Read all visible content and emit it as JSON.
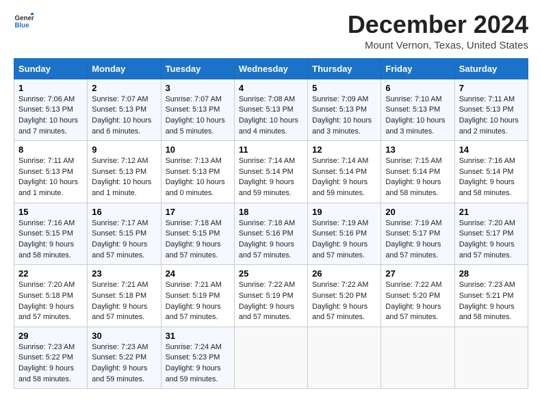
{
  "logo": {
    "line1": "General",
    "line2": "Blue"
  },
  "title": "December 2024",
  "subtitle": "Mount Vernon, Texas, United States",
  "columns": [
    "Sunday",
    "Monday",
    "Tuesday",
    "Wednesday",
    "Thursday",
    "Friday",
    "Saturday"
  ],
  "weeks": [
    [
      {
        "day": "1",
        "info": "Sunrise: 7:06 AM\nSunset: 5:13 PM\nDaylight: 10 hours and 7 minutes."
      },
      {
        "day": "2",
        "info": "Sunrise: 7:07 AM\nSunset: 5:13 PM\nDaylight: 10 hours and 6 minutes."
      },
      {
        "day": "3",
        "info": "Sunrise: 7:07 AM\nSunset: 5:13 PM\nDaylight: 10 hours and 5 minutes."
      },
      {
        "day": "4",
        "info": "Sunrise: 7:08 AM\nSunset: 5:13 PM\nDaylight: 10 hours and 4 minutes."
      },
      {
        "day": "5",
        "info": "Sunrise: 7:09 AM\nSunset: 5:13 PM\nDaylight: 10 hours and 3 minutes."
      },
      {
        "day": "6",
        "info": "Sunrise: 7:10 AM\nSunset: 5:13 PM\nDaylight: 10 hours and 3 minutes."
      },
      {
        "day": "7",
        "info": "Sunrise: 7:11 AM\nSunset: 5:13 PM\nDaylight: 10 hours and 2 minutes."
      }
    ],
    [
      {
        "day": "8",
        "info": "Sunrise: 7:11 AM\nSunset: 5:13 PM\nDaylight: 10 hours and 1 minute."
      },
      {
        "day": "9",
        "info": "Sunrise: 7:12 AM\nSunset: 5:13 PM\nDaylight: 10 hours and 1 minute."
      },
      {
        "day": "10",
        "info": "Sunrise: 7:13 AM\nSunset: 5:13 PM\nDaylight: 10 hours and 0 minutes."
      },
      {
        "day": "11",
        "info": "Sunrise: 7:14 AM\nSunset: 5:14 PM\nDaylight: 9 hours and 59 minutes."
      },
      {
        "day": "12",
        "info": "Sunrise: 7:14 AM\nSunset: 5:14 PM\nDaylight: 9 hours and 59 minutes."
      },
      {
        "day": "13",
        "info": "Sunrise: 7:15 AM\nSunset: 5:14 PM\nDaylight: 9 hours and 58 minutes."
      },
      {
        "day": "14",
        "info": "Sunrise: 7:16 AM\nSunset: 5:14 PM\nDaylight: 9 hours and 58 minutes."
      }
    ],
    [
      {
        "day": "15",
        "info": "Sunrise: 7:16 AM\nSunset: 5:15 PM\nDaylight: 9 hours and 58 minutes."
      },
      {
        "day": "16",
        "info": "Sunrise: 7:17 AM\nSunset: 5:15 PM\nDaylight: 9 hours and 57 minutes."
      },
      {
        "day": "17",
        "info": "Sunrise: 7:18 AM\nSunset: 5:15 PM\nDaylight: 9 hours and 57 minutes."
      },
      {
        "day": "18",
        "info": "Sunrise: 7:18 AM\nSunset: 5:16 PM\nDaylight: 9 hours and 57 minutes."
      },
      {
        "day": "19",
        "info": "Sunrise: 7:19 AM\nSunset: 5:16 PM\nDaylight: 9 hours and 57 minutes."
      },
      {
        "day": "20",
        "info": "Sunrise: 7:19 AM\nSunset: 5:17 PM\nDaylight: 9 hours and 57 minutes."
      },
      {
        "day": "21",
        "info": "Sunrise: 7:20 AM\nSunset: 5:17 PM\nDaylight: 9 hours and 57 minutes."
      }
    ],
    [
      {
        "day": "22",
        "info": "Sunrise: 7:20 AM\nSunset: 5:18 PM\nDaylight: 9 hours and 57 minutes."
      },
      {
        "day": "23",
        "info": "Sunrise: 7:21 AM\nSunset: 5:18 PM\nDaylight: 9 hours and 57 minutes."
      },
      {
        "day": "24",
        "info": "Sunrise: 7:21 AM\nSunset: 5:19 PM\nDaylight: 9 hours and 57 minutes."
      },
      {
        "day": "25",
        "info": "Sunrise: 7:22 AM\nSunset: 5:19 PM\nDaylight: 9 hours and 57 minutes."
      },
      {
        "day": "26",
        "info": "Sunrise: 7:22 AM\nSunset: 5:20 PM\nDaylight: 9 hours and 57 minutes."
      },
      {
        "day": "27",
        "info": "Sunrise: 7:22 AM\nSunset: 5:20 PM\nDaylight: 9 hours and 57 minutes."
      },
      {
        "day": "28",
        "info": "Sunrise: 7:23 AM\nSunset: 5:21 PM\nDaylight: 9 hours and 58 minutes."
      }
    ],
    [
      {
        "day": "29",
        "info": "Sunrise: 7:23 AM\nSunset: 5:22 PM\nDaylight: 9 hours and 58 minutes."
      },
      {
        "day": "30",
        "info": "Sunrise: 7:23 AM\nSunset: 5:22 PM\nDaylight: 9 hours and 59 minutes."
      },
      {
        "day": "31",
        "info": "Sunrise: 7:24 AM\nSunset: 5:23 PM\nDaylight: 9 hours and 59 minutes."
      },
      null,
      null,
      null,
      null
    ]
  ]
}
